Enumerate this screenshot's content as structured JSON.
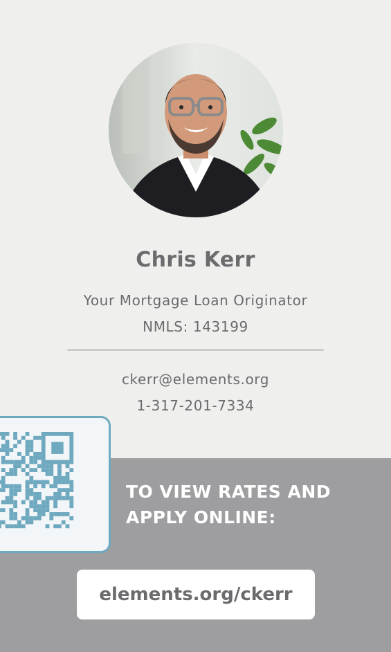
{
  "profile": {
    "name": "Chris Kerr",
    "title": "Your Mortgage Loan Originator",
    "nmls": "NMLS: 143199",
    "email": "ckerr@elements.org",
    "phone": "1-317-201-7334"
  },
  "cta": {
    "line1": "TO VIEW RATES AND",
    "line2": "APPLY ONLINE:",
    "url": "elements.org/ckerr"
  },
  "colors": {
    "card_background": "#efefed",
    "footer_background": "#9e9ea1",
    "text_gray": "#6b6b6e",
    "qr_accent": "#6ea9bf",
    "white": "#ffffff"
  },
  "icons": [
    "profile-photo",
    "qr-code-icon"
  ]
}
